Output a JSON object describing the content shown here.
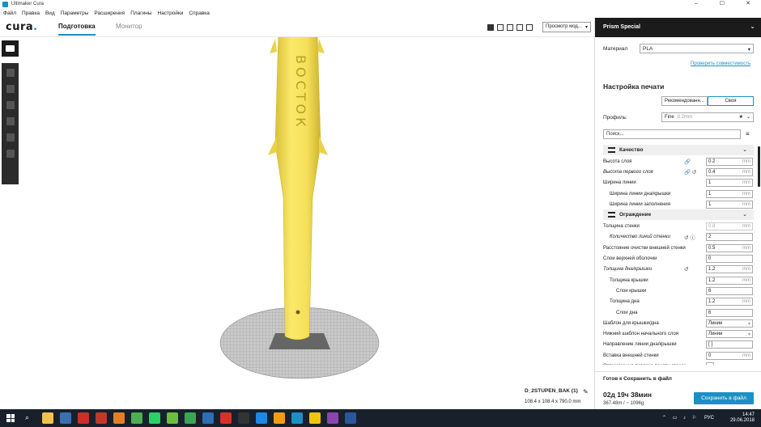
{
  "window": {
    "title": "Ultimaker Cura",
    "controls": [
      "–",
      "☐",
      "✕"
    ]
  },
  "menu": [
    "Файл",
    "Правка",
    "Вид",
    "Параметры",
    "Расширения",
    "Плагины",
    "Настройки",
    "Справка"
  ],
  "header": {
    "logo_text": "cura",
    "logo_dot": ".",
    "tabs": [
      {
        "label": "Подготовка",
        "active": true
      },
      {
        "label": "Монитор",
        "active": false
      }
    ],
    "view_select": "Просмотр мод...",
    "view_select_arrow": "▾"
  },
  "viewport": {
    "model_text": "ВОСТОК",
    "object_name": "D_2STUPEN_BAK (1)",
    "object_dims": "108.4 x 108.4 x 790.0 mm",
    "edit_icon": "✎",
    "colors": {
      "model": "#f5e05a",
      "model_shade": "#d9c138",
      "bed": "#b9b9b9"
    }
  },
  "panel": {
    "printer": "Prism Special",
    "printer_chevron": "⌄",
    "material_label": "Материал",
    "material_value": "PLA",
    "material_arrow": "▾",
    "compat_link": "Проверить совместимость",
    "settings_title": "Настройка печати",
    "mode_recommended": "Рекомендованн...",
    "mode_custom": "Своя",
    "profile_label": "Профиль:",
    "profile_value": "Fine",
    "profile_sub": "0.2mm",
    "profile_star": "★",
    "profile_arrow": "⌄",
    "search_placeholder": "Поиск...",
    "menu_icon": "≡",
    "categories": [
      {
        "label": "Качество",
        "chevron": "⌄",
        "rows": [
          {
            "label": "Высота слоя",
            "italic": false,
            "indent": 0,
            "icons": "🔗",
            "value": "0.2",
            "unit": "mm"
          },
          {
            "label": "Высота первого слоя",
            "italic": true,
            "indent": 0,
            "icons": "🔗 ↺",
            "value": "0.4",
            "unit": "mm"
          },
          {
            "label": "Ширина линии",
            "italic": false,
            "indent": 0,
            "icons": "",
            "value": "1",
            "unit": "mm"
          },
          {
            "label": "Ширина линии дна/крышки",
            "italic": false,
            "indent": 1,
            "icons": "",
            "value": "1",
            "unit": "mm"
          },
          {
            "label": "Ширина линии заполнения",
            "italic": false,
            "indent": 1,
            "icons": "",
            "value": "1",
            "unit": "mm"
          }
        ]
      },
      {
        "label": "Ограждение",
        "chevron": "⌄",
        "rows": [
          {
            "label": "Толщина стенки",
            "italic": false,
            "indent": 0,
            "icons": "",
            "value": "0.8",
            "unit": "mm",
            "disabled": true
          },
          {
            "label": "Количество линий стенки",
            "italic": true,
            "indent": 1,
            "icons": "↺ ⓘ",
            "value": "2",
            "unit": ""
          },
          {
            "label": "Расстояние очистки внешней стенки",
            "italic": false,
            "indent": 0,
            "icons": "",
            "value": "0.5",
            "unit": "mm"
          },
          {
            "label": "Слои верхней оболочки",
            "italic": false,
            "indent": 0,
            "icons": "",
            "value": "0",
            "unit": ""
          },
          {
            "label": "Толщина дна/крышки",
            "italic": true,
            "indent": 0,
            "icons": "↺",
            "value": "1.2",
            "unit": "mm"
          },
          {
            "label": "Толщина крышки",
            "italic": false,
            "indent": 1,
            "icons": "",
            "value": "1.2",
            "unit": "mm"
          },
          {
            "label": "Слои крышки",
            "italic": false,
            "indent": 2,
            "icons": "",
            "value": "6",
            "unit": ""
          },
          {
            "label": "Толщина дна",
            "italic": false,
            "indent": 1,
            "icons": "",
            "value": "1.2",
            "unit": "mm"
          },
          {
            "label": "Слои дна",
            "italic": false,
            "indent": 2,
            "icons": "",
            "value": "6",
            "unit": ""
          },
          {
            "label": "Шаблон для крышки/дна",
            "italic": false,
            "indent": 0,
            "icons": "",
            "value": "Линии",
            "unit": "▾"
          },
          {
            "label": "Нижний шаблон начального слоя",
            "italic": false,
            "indent": 0,
            "icons": "",
            "value": "Линии",
            "unit": "▾"
          },
          {
            "label": "Направление линии дна/крышки",
            "italic": false,
            "indent": 0,
            "icons": "",
            "value": "[ ]",
            "unit": ""
          },
          {
            "label": "Вставка внешней стенки",
            "italic": false,
            "indent": 0,
            "icons": "",
            "value": "0",
            "unit": "mm"
          },
          {
            "label": "Оптимазация порядка печати стенок",
            "italic": false,
            "indent": 0,
            "icons": "",
            "checkbox": true
          }
        ]
      }
    ],
    "ready_label": "Готов к Сохранить в файл",
    "print_time": "02д 19ч 38мин",
    "usage": "367.48m / ~ 1096g",
    "save_button": "Сохранить в файл"
  },
  "taskbar": {
    "lang": "РУС",
    "time": "14:47",
    "date": "29.06.2018",
    "tray_icons": "⌃ ▭ ♪ ⚐",
    "search_icon": "⌕",
    "apps": [
      {
        "name": "explorer",
        "color": "#f2c14e"
      },
      {
        "name": "app2",
        "color": "#3a6fb0"
      },
      {
        "name": "illustrator",
        "color": "#cc2f27"
      },
      {
        "name": "acad",
        "color": "#c0392b"
      },
      {
        "name": "app5",
        "color": "#e67e22"
      },
      {
        "name": "chrome",
        "color": "#4caf50"
      },
      {
        "name": "whatsapp",
        "color": "#25d366"
      },
      {
        "name": "app8",
        "color": "#6bbf3a"
      },
      {
        "name": "app9",
        "color": "#3aa655"
      },
      {
        "name": "app10",
        "color": "#2d6db5"
      },
      {
        "name": "acrobat",
        "color": "#d93025"
      },
      {
        "name": "app12",
        "color": "#333333"
      },
      {
        "name": "app13",
        "color": "#1e88e5"
      },
      {
        "name": "app14",
        "color": "#f39c12"
      },
      {
        "name": "cura",
        "color": "#1e8fc4"
      },
      {
        "name": "app16",
        "color": "#f1c40f"
      },
      {
        "name": "app17",
        "color": "#8e44ad"
      },
      {
        "name": "word",
        "color": "#2b579a"
      }
    ]
  }
}
